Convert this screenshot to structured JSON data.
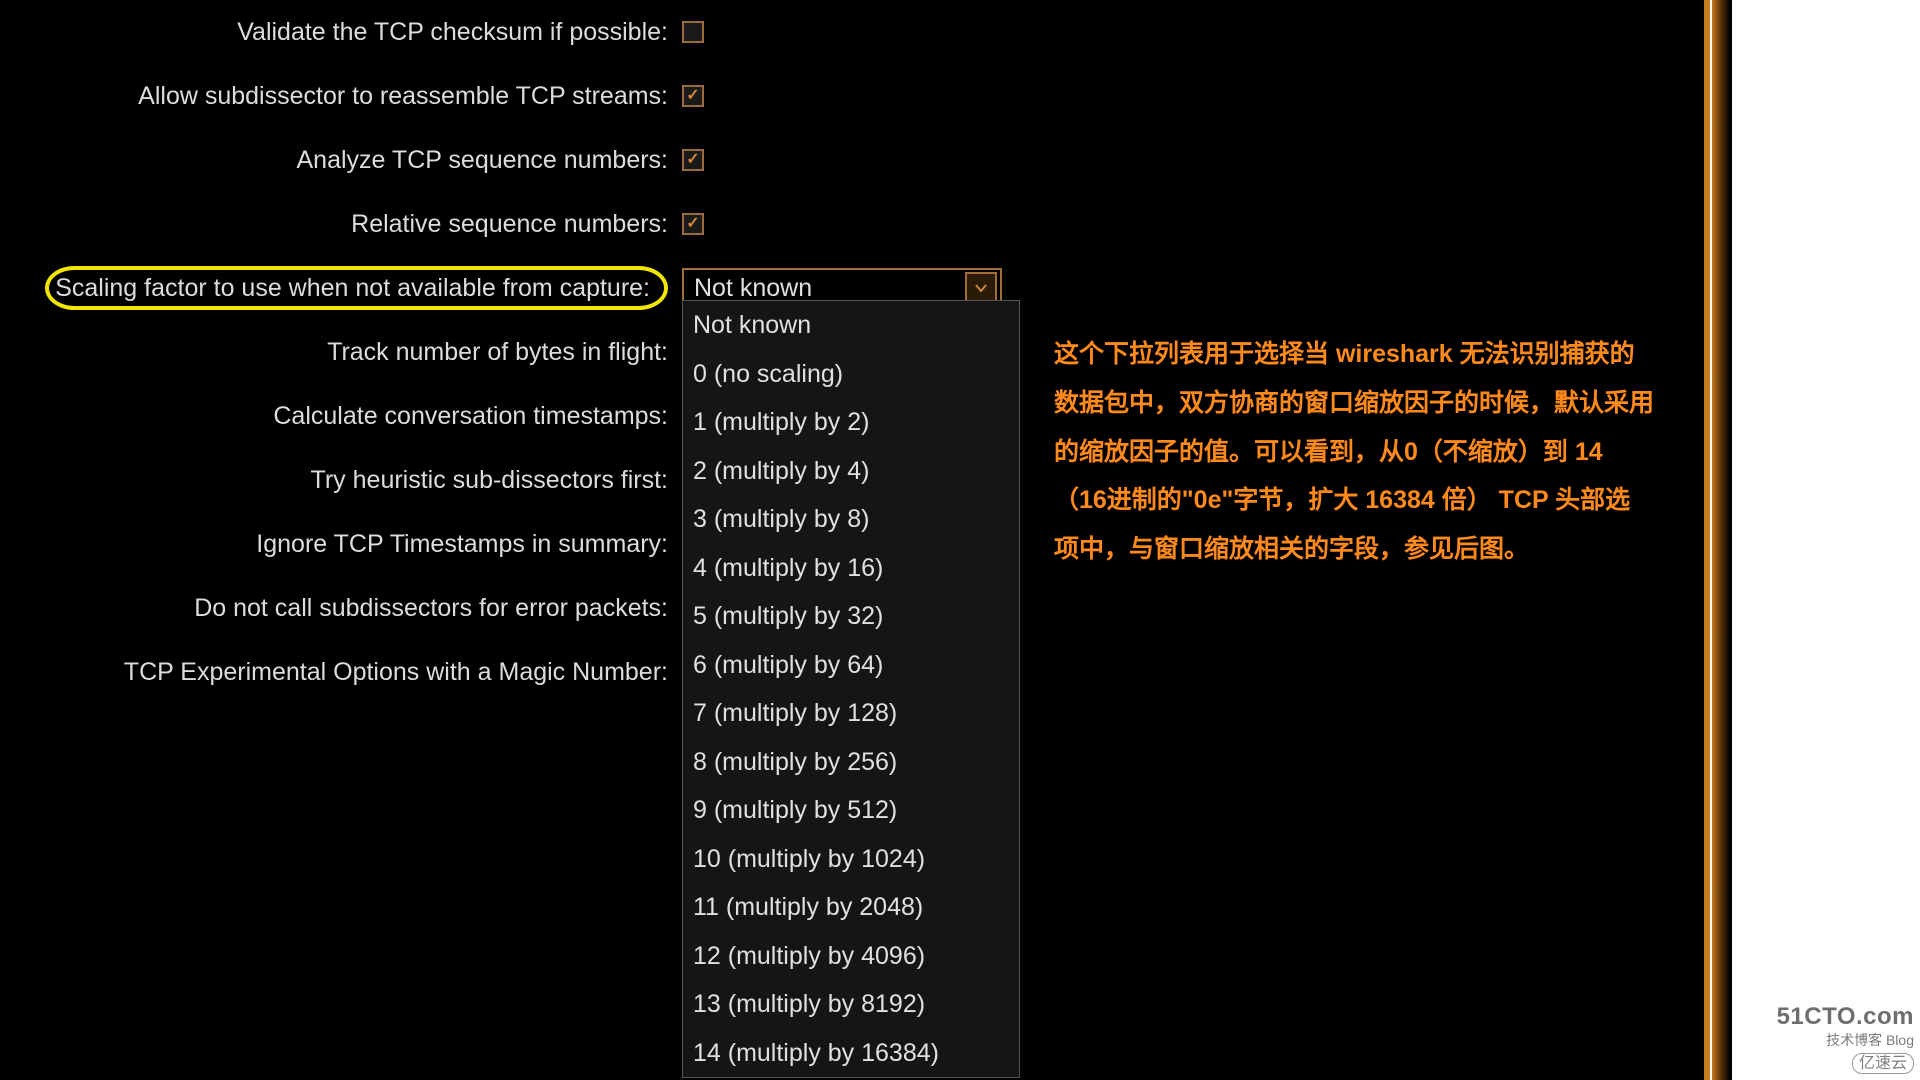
{
  "settings": {
    "items": [
      {
        "label": "Validate the TCP checksum if possible:",
        "checked": false,
        "highlight": false
      },
      {
        "label": "Allow subdissector to reassemble TCP streams:",
        "checked": true,
        "highlight": false
      },
      {
        "label": "Analyze TCP sequence numbers:",
        "checked": true,
        "highlight": false
      },
      {
        "label": "Relative sequence numbers:",
        "checked": true,
        "highlight": false
      }
    ],
    "scaling": {
      "label": "Scaling factor to use when not available from capture:",
      "selected": "Not known",
      "options": [
        "Not known",
        "0 (no scaling)",
        "1 (multiply by 2)",
        "2 (multiply by 4)",
        "3 (multiply by 8)",
        "4 (multiply by 16)",
        "5 (multiply by 32)",
        "6 (multiply by 64)",
        "7 (multiply by 128)",
        "8 (multiply by 256)",
        "9 (multiply by 512)",
        "10 (multiply by 1024)",
        "11 (multiply by 2048)",
        "12 (multiply by 4096)",
        "13 (multiply by 8192)",
        "14 (multiply by 16384)"
      ]
    },
    "after_items": [
      "Track number of bytes in flight:",
      "Calculate conversation timestamps:",
      "Try heuristic sub-dissectors first:",
      "Ignore TCP Timestamps in summary:",
      "Do not call subdissectors for error packets:",
      "TCP Experimental Options with a Magic Number:"
    ]
  },
  "annotation": {
    "text": " 这个下拉列表用于选择当 wireshark 无法识别捕获的数据包中，双方协商的窗口缩放因子的时候，默认采用的缩放因子的值。可以看到，从0（不缩放）到 14（16进制的\"0e\"字节，扩大 16384 倍） TCP 头部选项中，与窗口缩放相关的字段，参见后图。"
  },
  "watermark": {
    "line1": "51CTO.com",
    "line2": "技术博客  Blog",
    "line3": "亿速云"
  }
}
